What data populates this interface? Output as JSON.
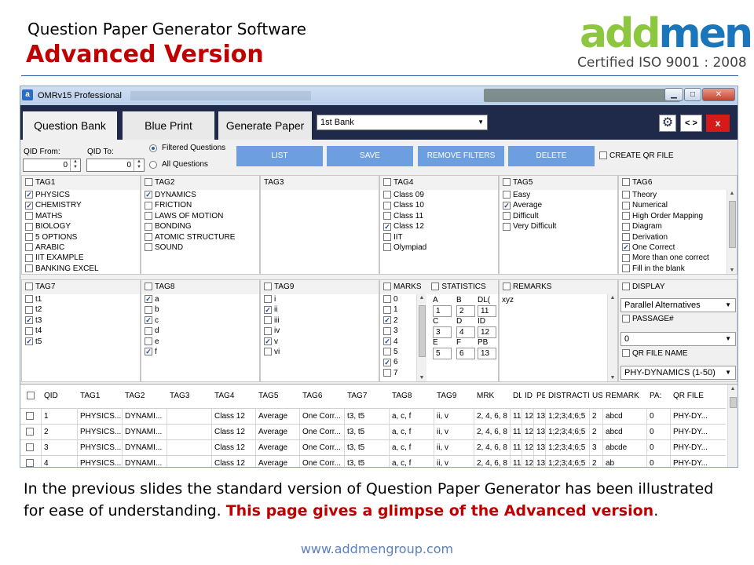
{
  "slide": {
    "title1": "Question Paper Generator Software",
    "title2": "Advanced Version",
    "logo_part1": "add",
    "logo_part2": "men",
    "iso": "Certified ISO 9001 : 2008",
    "para_plain": "In the previous slides the standard version of Question Paper Generator has been illustrated for ease of understanding. ",
    "para_red": "This page gives a glimpse of the Advanced version",
    "para_end": ".",
    "url": "www.addmengroup.com"
  },
  "window": {
    "icon": "a",
    "title": "OMRv15 Professional",
    "min": "▁",
    "max": "□",
    "close": "✕"
  },
  "tabs": {
    "question_bank": "Question Bank",
    "blue_print": "Blue Print",
    "generate_paper": "Generate Paper"
  },
  "bank_select": {
    "value": "1st Bank"
  },
  "toolbar": {
    "settings_icon": "gear-icon",
    "nav_label": "< >",
    "close_label": "x"
  },
  "filters": {
    "qid_from_label": "QID From:",
    "qid_to_label": "QID To:",
    "qid_from": "0",
    "qid_to": "0",
    "filtered_questions": "Filtered Questions",
    "all_questions": "All Questions",
    "selected": "Filtered Questions"
  },
  "buttons": {
    "list": "LIST",
    "save": "SAVE",
    "remove_filters": "REMOVE FILTERS",
    "delete": "DELETE",
    "create_qr": "CREATE QR FILE"
  },
  "tag1": {
    "title": "TAG1",
    "items": [
      {
        "label": "PHYSICS",
        "checked": true
      },
      {
        "label": "CHEMISTRY",
        "checked": true
      },
      {
        "label": "MATHS",
        "checked": false
      },
      {
        "label": "BIOLOGY",
        "checked": false
      },
      {
        "label": "5 OPTIONS",
        "checked": false
      },
      {
        "label": "ARABIC",
        "checked": false
      },
      {
        "label": "IIT EXAMPLE",
        "checked": false
      },
      {
        "label": "BANKING EXCEL",
        "checked": false
      }
    ]
  },
  "tag2": {
    "title": "TAG2",
    "items": [
      {
        "label": "DYNAMICS",
        "checked": true
      },
      {
        "label": "FRICTION",
        "checked": false
      },
      {
        "label": "LAWS OF MOTION",
        "checked": false
      },
      {
        "label": "BONDING",
        "checked": false
      },
      {
        "label": "ATOMIC STRUCTURE",
        "checked": false
      },
      {
        "label": "SOUND",
        "checked": false
      }
    ]
  },
  "tag3": {
    "title": "TAG3",
    "items": []
  },
  "tag4": {
    "title": "TAG4",
    "items": [
      {
        "label": "Class 09",
        "checked": false
      },
      {
        "label": "Class 10",
        "checked": false
      },
      {
        "label": "Class 11",
        "checked": false
      },
      {
        "label": "Class 12",
        "checked": true
      },
      {
        "label": "IIT",
        "checked": false
      },
      {
        "label": "Olympiad",
        "checked": false
      }
    ]
  },
  "tag5": {
    "title": "TAG5",
    "items": [
      {
        "label": "Easy",
        "checked": false
      },
      {
        "label": "Average",
        "checked": true
      },
      {
        "label": "Difficult",
        "checked": false
      },
      {
        "label": "Very Difficult",
        "checked": false
      }
    ]
  },
  "tag6": {
    "title": "TAG6",
    "items": [
      {
        "label": "Theory",
        "checked": false
      },
      {
        "label": "Numerical",
        "checked": false
      },
      {
        "label": "High Order Mapping",
        "checked": false
      },
      {
        "label": "Diagram",
        "checked": false
      },
      {
        "label": "Derivation",
        "checked": false
      },
      {
        "label": "One Correct",
        "checked": true
      },
      {
        "label": "More than one correct",
        "checked": false
      },
      {
        "label": "Fill in the blank",
        "checked": false
      }
    ]
  },
  "tag7": {
    "title": "TAG7",
    "items": [
      {
        "label": "t1",
        "checked": false
      },
      {
        "label": "t2",
        "checked": false
      },
      {
        "label": "t3",
        "checked": true
      },
      {
        "label": "t4",
        "checked": false
      },
      {
        "label": "t5",
        "checked": true
      }
    ]
  },
  "tag8": {
    "title": "TAG8",
    "items": [
      {
        "label": "a",
        "checked": true
      },
      {
        "label": "b",
        "checked": false
      },
      {
        "label": "c",
        "checked": true
      },
      {
        "label": "d",
        "checked": false
      },
      {
        "label": "e",
        "checked": false
      },
      {
        "label": "f",
        "checked": true
      }
    ]
  },
  "tag9": {
    "title": "TAG9",
    "items": [
      {
        "label": "i",
        "checked": false
      },
      {
        "label": "ii",
        "checked": true
      },
      {
        "label": "iii",
        "checked": false
      },
      {
        "label": "iv",
        "checked": false
      },
      {
        "label": "v",
        "checked": true
      },
      {
        "label": "vi",
        "checked": false
      }
    ]
  },
  "marks": {
    "title": "MARKS",
    "items": [
      {
        "label": "0",
        "checked": false
      },
      {
        "label": "1",
        "checked": false
      },
      {
        "label": "2",
        "checked": true
      },
      {
        "label": "3",
        "checked": false
      },
      {
        "label": "4",
        "checked": true
      },
      {
        "label": "5",
        "checked": false
      },
      {
        "label": "6",
        "checked": true
      },
      {
        "label": "7",
        "checked": false
      }
    ]
  },
  "statistics": {
    "title": "STATISTICS",
    "labels": [
      "A",
      "B",
      "DL(",
      "C",
      "D",
      "ID",
      "E",
      "F",
      "PB"
    ],
    "values": [
      "1",
      "2",
      "11",
      "3",
      "4",
      "12",
      "5",
      "6",
      "13"
    ]
  },
  "remarks": {
    "title": "REMARKS",
    "value": "xyz"
  },
  "display": {
    "title": "DISPLAY",
    "display_value": "Parallel Alternatives",
    "passage_label": "PASSAGE#",
    "passage_value": "0",
    "qr_label": "QR FILE NAME",
    "qr_value": "PHY-DYNAMICS (1-50)"
  },
  "table": {
    "headers": [
      "QID",
      "TAG1",
      "TAG2",
      "TAG3",
      "TAG4",
      "TAG5",
      "TAG6",
      "TAG7",
      "TAG8",
      "TAG9",
      "MRK",
      "DL",
      "ID",
      "PE",
      "DISTRACTI",
      "US",
      "REMARK",
      "PA:",
      "QR FILE"
    ],
    "rows": [
      [
        "1",
        "PHYSICS...",
        "DYNAMI...",
        "",
        "Class 12",
        "Average",
        "One Corr...",
        "t3, t5",
        "a, c, f",
        "ii, v",
        "2, 4, 6, 8",
        "11",
        "12",
        "13",
        "1;2;3;4;6;5",
        "2",
        "abcd",
        "0",
        "PHY-DY..."
      ],
      [
        "2",
        "PHYSICS...",
        "DYNAMI...",
        "",
        "Class 12",
        "Average",
        "One Corr...",
        "t3, t5",
        "a, c, f",
        "ii, v",
        "2, 4, 6, 8",
        "11",
        "12",
        "13",
        "1;2;3;4;6;5",
        "2",
        "abcd",
        "0",
        "PHY-DY..."
      ],
      [
        "3",
        "PHYSICS...",
        "DYNAMI...",
        "",
        "Class 12",
        "Average",
        "One Corr...",
        "t3, t5",
        "a, c, f",
        "ii, v",
        "2, 4, 6, 8",
        "11",
        "12",
        "13",
        "1;2;3;4;6;5",
        "3",
        "abcde",
        "0",
        "PHY-DY..."
      ],
      [
        "4",
        "PHYSICS...",
        "DYNAMI...",
        "",
        "Class 12",
        "Average",
        "One Corr...",
        "t3, t5",
        "a, c, f",
        "ii, v",
        "2, 4, 6, 8",
        "11",
        "12",
        "13",
        "1;2;3;4;6;5",
        "2",
        "ab",
        "0",
        "PHY-DY..."
      ]
    ]
  }
}
